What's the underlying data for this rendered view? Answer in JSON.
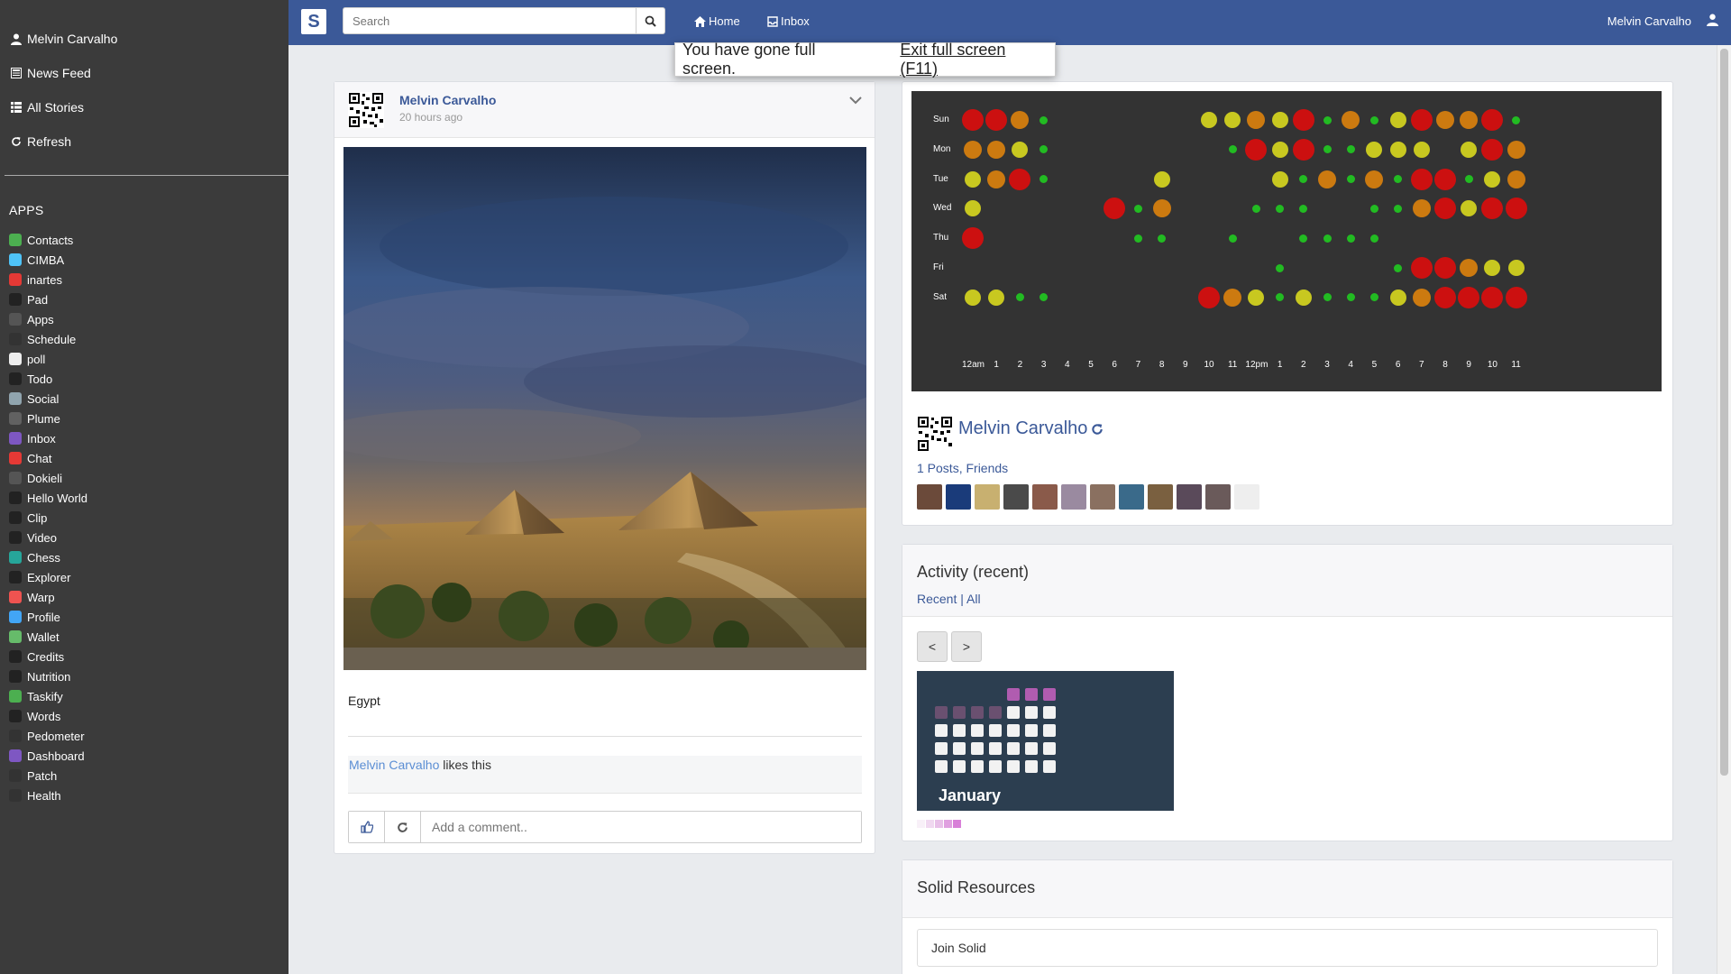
{
  "sidebar": {
    "nav": [
      {
        "label": "Melvin Carvalho",
        "icon": "user-icon"
      },
      {
        "label": "News Feed",
        "icon": "newspaper-icon"
      },
      {
        "label": "All Stories",
        "icon": "list-icon"
      },
      {
        "label": "Refresh",
        "icon": "refresh-icon"
      }
    ],
    "apps_title": "APPS",
    "apps": [
      {
        "label": "Contacts",
        "color": "#4caf50"
      },
      {
        "label": "CIMBA",
        "color": "#4fc3f7"
      },
      {
        "label": "inartes",
        "color": "#e53935"
      },
      {
        "label": "Pad",
        "color": "#222222"
      },
      {
        "label": "Apps",
        "color": "#555555"
      },
      {
        "label": "Schedule",
        "color": "#333333"
      },
      {
        "label": "poll",
        "color": "#eeeeee"
      },
      {
        "label": "Todo",
        "color": "#222222"
      },
      {
        "label": "Social",
        "color": "#90a4ae"
      },
      {
        "label": "Plume",
        "color": "#616161"
      },
      {
        "label": "Inbox",
        "color": "#7e57c2"
      },
      {
        "label": "Chat",
        "color": "#e53935"
      },
      {
        "label": "Dokieli",
        "color": "#555555"
      },
      {
        "label": "Hello World",
        "color": "#222222"
      },
      {
        "label": "Clip",
        "color": "#222222"
      },
      {
        "label": "Video",
        "color": "#222222"
      },
      {
        "label": "Chess",
        "color": "#26a69a"
      },
      {
        "label": "Explorer",
        "color": "#222222"
      },
      {
        "label": "Warp",
        "color": "#ef5350"
      },
      {
        "label": "Profile",
        "color": "#42a5f5"
      },
      {
        "label": "Wallet",
        "color": "#66bb6a"
      },
      {
        "label": "Credits",
        "color": "#222222"
      },
      {
        "label": "Nutrition",
        "color": "#222222"
      },
      {
        "label": "Taskify",
        "color": "#4caf50"
      },
      {
        "label": "Words",
        "color": "#222222"
      },
      {
        "label": "Pedometer",
        "color": "#333333"
      },
      {
        "label": "Dashboard",
        "color": "#7e57c2"
      },
      {
        "label": "Patch",
        "color": "#333333"
      },
      {
        "label": "Health",
        "color": "#333333"
      }
    ]
  },
  "topbar": {
    "logo": "S",
    "search_placeholder": "Search",
    "home": "Home",
    "inbox": "Inbox",
    "user": "Melvin Carvalho"
  },
  "fullscreen": {
    "message": "You have gone full screen.",
    "exit": "Exit full screen (F11)"
  },
  "post": {
    "author": "Melvin Carvalho",
    "time": "20 hours ago",
    "text": "Egypt",
    "liker": "Melvin Carvalho",
    "likes_suffix": "likes this",
    "comment_placeholder": "Add a comment.."
  },
  "punchcard": {
    "days": [
      "Sun",
      "Mon",
      "Tue",
      "Wed",
      "Thu",
      "Fri",
      "Sat"
    ],
    "hours": [
      "12am",
      "1",
      "2",
      "3",
      "4",
      "5",
      "6",
      "7",
      "8",
      "9",
      "10",
      "11",
      "12pm",
      "1",
      "2",
      "3",
      "4",
      "5",
      "6",
      "7",
      "8",
      "9",
      "10",
      "11"
    ],
    "levels": [
      [
        4,
        4,
        3,
        1,
        0,
        0,
        0,
        0,
        0,
        0,
        2,
        2,
        3,
        2,
        4,
        1,
        3,
        1,
        2,
        4,
        3,
        3,
        4,
        1
      ],
      [
        3,
        3,
        2,
        1,
        0,
        0,
        0,
        0,
        0,
        0,
        0,
        1,
        4,
        2,
        4,
        1,
        1,
        2,
        2,
        2,
        0,
        2,
        4,
        3
      ],
      [
        2,
        3,
        4,
        1,
        0,
        0,
        0,
        0,
        2,
        0,
        0,
        0,
        0,
        2,
        1,
        3,
        1,
        3,
        1,
        4,
        4,
        1,
        2,
        3
      ],
      [
        2,
        0,
        0,
        0,
        0,
        0,
        4,
        1,
        3,
        0,
        0,
        0,
        1,
        1,
        1,
        0,
        0,
        1,
        1,
        3,
        4,
        2,
        4,
        4
      ],
      [
        4,
        0,
        0,
        0,
        0,
        0,
        0,
        1,
        1,
        0,
        0,
        1,
        0,
        0,
        1,
        1,
        1,
        1,
        0,
        0,
        0,
        0,
        0,
        0
      ],
      [
        0,
        0,
        0,
        0,
        0,
        0,
        0,
        0,
        0,
        0,
        0,
        0,
        0,
        1,
        0,
        0,
        0,
        0,
        1,
        4,
        4,
        3,
        2,
        2
      ],
      [
        2,
        2,
        1,
        1,
        0,
        0,
        0,
        0,
        0,
        0,
        4,
        3,
        2,
        1,
        2,
        1,
        1,
        1,
        2,
        3,
        4,
        4,
        4,
        4
      ]
    ],
    "level_colors": [
      "",
      "#22bb22",
      "#c8c820",
      "#cc7a10",
      "#cc1010"
    ]
  },
  "profile": {
    "name": "Melvin Carvalho",
    "posts": "1 Posts",
    "friends": "Friends",
    "friend_colors": [
      "#6b4a3a",
      "#1a3b7a",
      "#c8b070",
      "#4a4a4a",
      "#8a5a4a",
      "#9a8aa0",
      "#8a7060",
      "#3a6a8a",
      "#7a6040",
      "#5a4a5a",
      "#6a5a5a",
      "#eeeeee"
    ]
  },
  "activity": {
    "title": "Activity (recent)",
    "recent": "Recent",
    "separator": "|",
    "all": "All",
    "prev": "<",
    "next": ">",
    "month": "January"
  },
  "resources": {
    "title": "Solid Resources",
    "join": "Join Solid"
  }
}
